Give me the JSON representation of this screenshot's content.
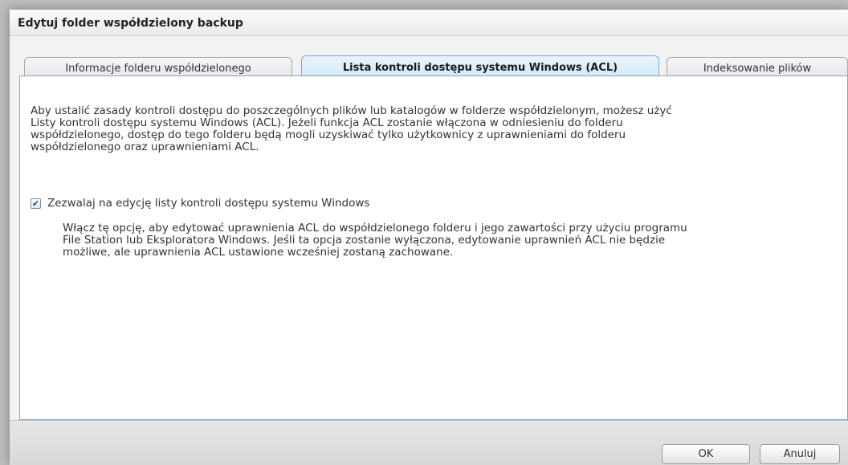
{
  "window": {
    "title": "Edytuj folder współdzielony backup"
  },
  "tabs": [
    {
      "label": "Informacje folderu współdzielonego",
      "active": false
    },
    {
      "label": "Lista kontroli dostępu systemu Windows (ACL)",
      "active": true
    },
    {
      "label": "Indeksowanie plików",
      "active": false
    }
  ],
  "panel": {
    "description": "Aby ustalić zasady kontroli dostępu do poszczególnych plików lub katalogów w folderze współdzielonym, możesz użyć\nListy kontroli dostępu systemu Windows (ACL). Jeżeli funkcja ACL zostanie włączona w odniesieniu do folderu\nwspółdzielonego, dostęp do tego folderu będą mogli uzyskiwać tylko użytkownicy z uprawnieniami do folderu\nwspółdzielonego oraz uprawnieniami ACL.",
    "acl_option": {
      "checked": true,
      "check_glyph": "✔",
      "label": "Zezwalaj na edycję listy kontroli dostępu systemu Windows",
      "description": "Włącz tę opcję, aby edytować uprawnienia ACL do współdzielonego folderu i jego zawartości przy użyciu programu\nFile Station lub Eksploratora Windows. Jeśli ta opcja zostanie wyłączona, edytowanie uprawnień ACL nie będzie\nmożliwe, ale uprawnienia ACL ustawione wcześniej zostaną zachowane."
    }
  },
  "footer": {
    "ok_label": "OK",
    "cancel_label": "Anuluj"
  },
  "colors": {
    "accent_border": "#7aa7d0",
    "active_tab": "#d2e7f8"
  }
}
